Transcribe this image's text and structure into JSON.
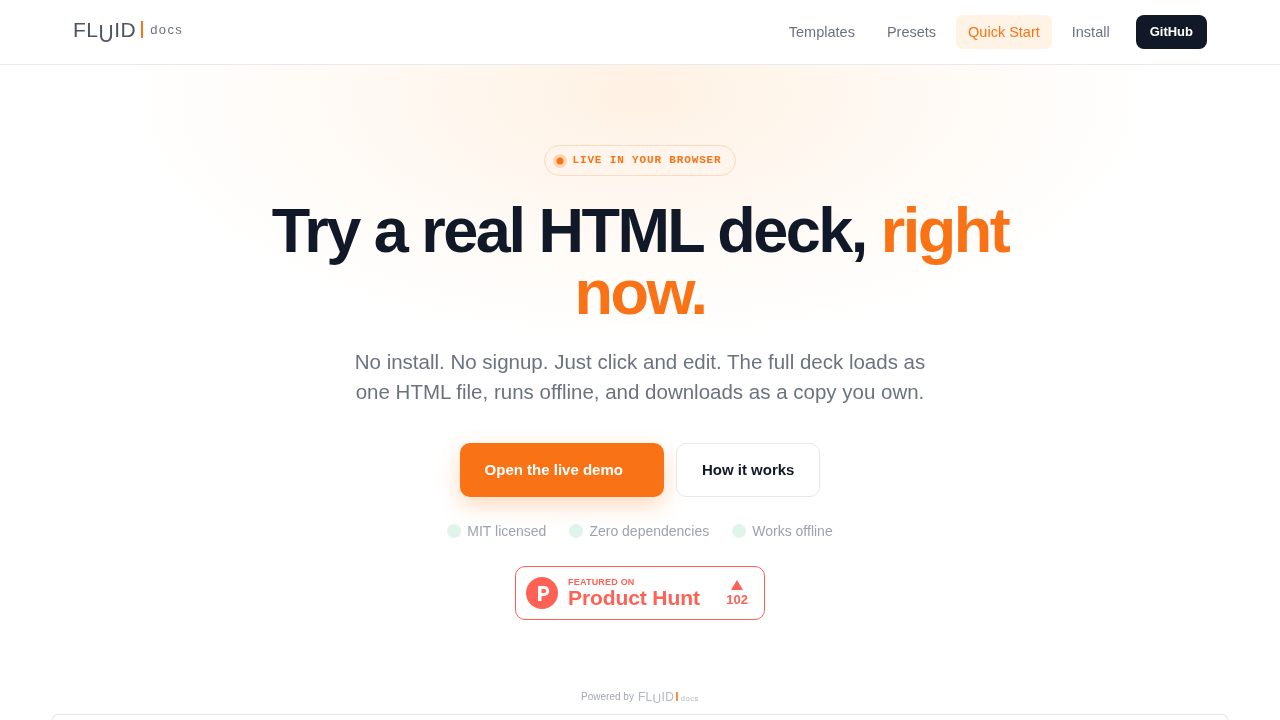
{
  "nav": {
    "logo": {
      "wordmark": "FLUID",
      "suffix": "docs"
    },
    "links": [
      {
        "label": "Templates",
        "selected": false
      },
      {
        "label": "Presets",
        "selected": false
      },
      {
        "label": "Quick Start",
        "selected": true
      },
      {
        "label": "Install",
        "selected": false
      }
    ],
    "cta": "GitHub"
  },
  "hero": {
    "badge": "LIVE IN YOUR BROWSER",
    "title": "Try a real HTML deck,",
    "title_highlight": "right now.",
    "subtitle": "No install. No signup. Just click and edit. The full deck loads as one HTML file, runs offline, and downloads as a copy you own.",
    "buttons": [
      {
        "label": "Open the live demo",
        "kind": "primary"
      },
      {
        "label": "How it works",
        "kind": "secondary"
      }
    ],
    "features": [
      "MIT licensed",
      "Zero dependencies",
      "Works offline"
    ],
    "product_hunt": {
      "kicker": "FEATURED ON",
      "name": "Product Hunt",
      "votes": "102"
    }
  },
  "footer": {
    "powered_by": "Powered by",
    "logo": {
      "wordmark": "FLUID",
      "suffix": "docs"
    }
  }
}
